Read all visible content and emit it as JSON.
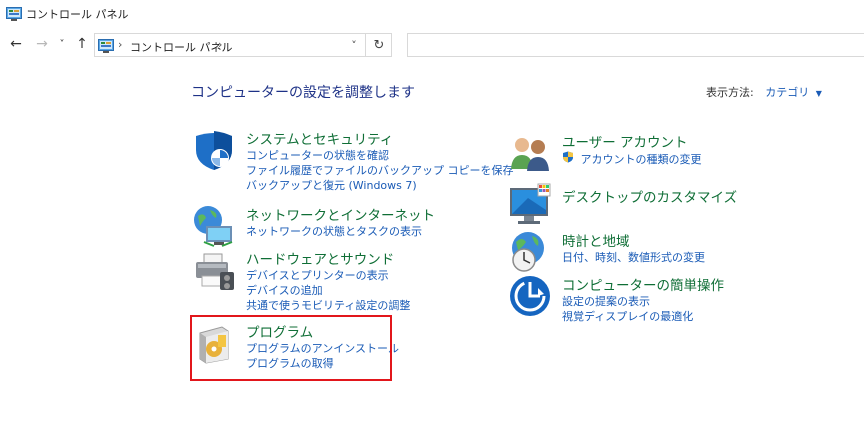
{
  "window": {
    "title": "コントロール パネル"
  },
  "nav": {
    "back_label": "←",
    "forward_label": "→",
    "recent_label": "˅",
    "up_label": "↑",
    "breadcrumb_sep": "›",
    "breadcrumb": "コントロール パネル",
    "breadcrumb_trailing_sep": "›",
    "address_dropdown_label": "˅",
    "refresh_label": "↻",
    "search_placeholder": ""
  },
  "header": {
    "title": "コンピューターの設定を調整します",
    "view_by_label": "表示方法:",
    "view_by_value": "カテゴリ",
    "view_by_caret": "▼"
  },
  "categories": {
    "system": {
      "title": "システムとセキュリティ",
      "links": [
        "コンピューターの状態を確認",
        "ファイル履歴でファイルのバックアップ コピーを保存",
        "バックアップと復元 (Windows 7)"
      ]
    },
    "network": {
      "title": "ネットワークとインターネット",
      "links": [
        "ネットワークの状態とタスクの表示"
      ]
    },
    "hardware": {
      "title": "ハードウェアとサウンド",
      "links": [
        "デバイスとプリンターの表示",
        "デバイスの追加",
        "共通で使うモビリティ設定の調整"
      ]
    },
    "programs": {
      "title": "プログラム",
      "links": [
        "プログラムのアンインストール",
        "プログラムの取得"
      ]
    },
    "users": {
      "title": "ユーザー アカウント",
      "links": [
        "アカウントの種類の変更"
      ]
    },
    "appearance": {
      "title": "デスクトップのカスタマイズ",
      "links": []
    },
    "clock": {
      "title": "時計と地域",
      "links": [
        "日付、時刻、数値形式の変更"
      ]
    },
    "ease": {
      "title": "コンピューターの簡単操作",
      "links": [
        "設定の提案の表示",
        "視覚ディスプレイの最適化"
      ]
    }
  },
  "colors": {
    "category_title": "#0f6e36",
    "link": "#1a5bb6",
    "page_title": "#1e3287",
    "highlight_border": "#e2161b"
  },
  "icons": {
    "app": "control-panel-icon",
    "system": "shield-icon",
    "network": "network-globe-icon",
    "hardware": "printer-icon",
    "programs": "programs-disc-icon",
    "users": "users-icon",
    "appearance": "desktop-monitor-icon",
    "clock": "clock-globe-icon",
    "ease": "ease-of-access-icon",
    "uac": "uac-shield-icon"
  }
}
